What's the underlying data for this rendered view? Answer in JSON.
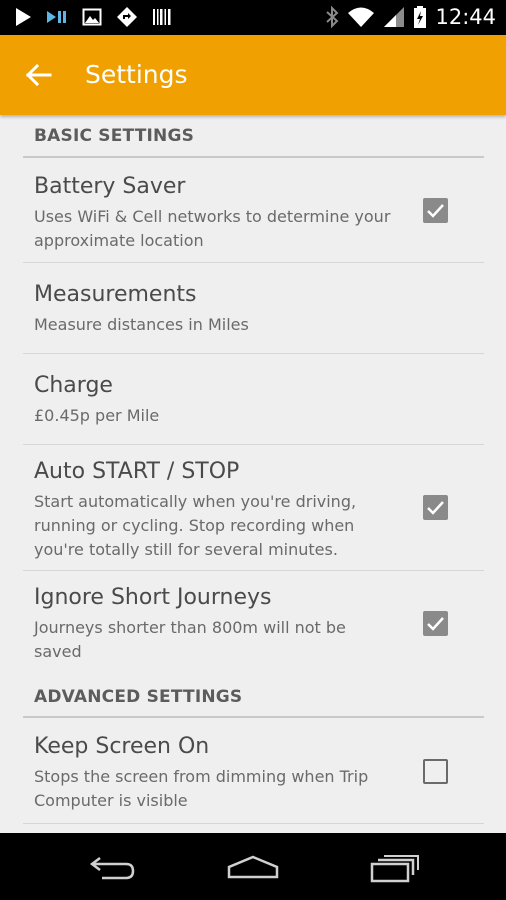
{
  "status_bar": {
    "time": "12:44",
    "icons_left": [
      "play-icon",
      "cast-icon",
      "image-icon",
      "directions-icon",
      "barcode-icon"
    ],
    "icons_right": [
      "bluetooth-icon",
      "wifi-icon",
      "signal-icon",
      "battery-charging-icon"
    ]
  },
  "app_bar": {
    "title": "Settings",
    "back_icon": "arrow-left-icon",
    "color": "#f0a000"
  },
  "sections": {
    "basic": {
      "header": "BASIC SETTINGS"
    },
    "advanced": {
      "header": "ADVANCED SETTINGS"
    }
  },
  "settings": {
    "battery_saver": {
      "title": "Battery Saver",
      "summary": "Uses WiFi & Cell networks to determine your approximate location",
      "checked": true
    },
    "measurements": {
      "title": "Measurements",
      "summary": "Measure distances in Miles"
    },
    "charge": {
      "title": "Charge",
      "summary": "£0.45p per Mile"
    },
    "auto_start_stop": {
      "title": "Auto START / STOP",
      "summary": "Start automatically when you're driving, running or cycling. Stop recording when you're totally still for several minutes.",
      "checked": true
    },
    "ignore_short": {
      "title": "Ignore Short Journeys",
      "summary": "Journeys shorter than 800m will not be saved",
      "checked": true
    },
    "keep_screen_on": {
      "title": "Keep Screen On",
      "summary": "Stops the screen from dimming when Trip Computer is visible",
      "checked": false
    }
  },
  "nav_bar": {
    "icons": [
      "nav-back-icon",
      "nav-home-icon",
      "nav-recents-icon"
    ]
  }
}
